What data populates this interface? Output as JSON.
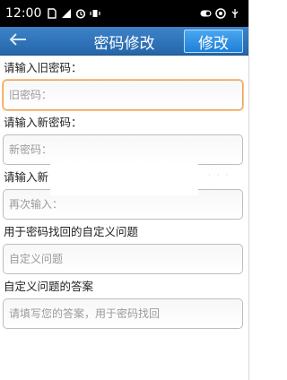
{
  "status_bar": {
    "time": "12:00",
    "icons": [
      "sim-card-icon",
      "signal-icon",
      "alarm-icon",
      "vibrate-icon",
      "toggle-icon",
      "app-icon",
      "usb-icon"
    ]
  },
  "title_bar": {
    "title": "密码修改",
    "submit_label": "修改",
    "back_icon": "back-arrow-icon"
  },
  "form": {
    "old_password": {
      "label": "请输入旧密码：",
      "placeholder": "旧密码："
    },
    "new_password": {
      "label": "请输入新密码：",
      "placeholder": "新密码："
    },
    "confirm_password": {
      "label": "请输入新",
      "placeholder": "再次输入："
    },
    "security_question": {
      "label": "用于密码找回的自定义问题",
      "placeholder": "自定义问题"
    },
    "security_answer": {
      "label": "自定义问题的答案",
      "placeholder": "请填写您的答案，用于密码找回"
    }
  },
  "colors": {
    "title_bar": "#2a6fb5",
    "submit_button": "#2b8ae0",
    "focus_border": "#f0a050"
  }
}
